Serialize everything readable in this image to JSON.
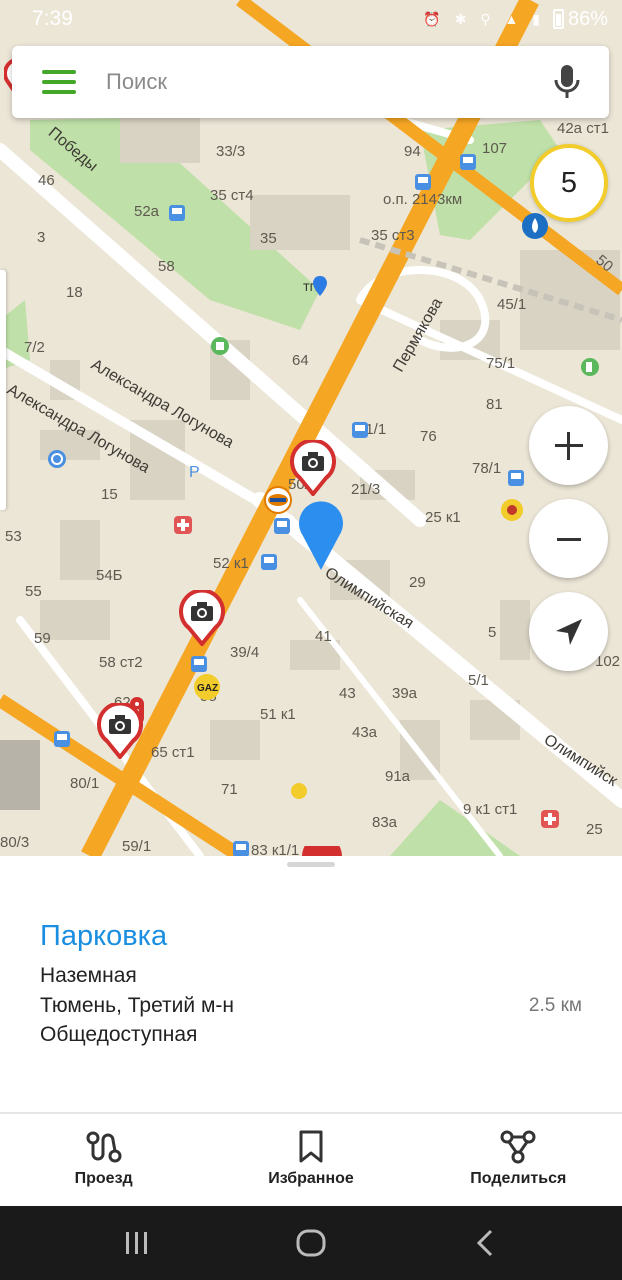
{
  "status_bar": {
    "time": "7:39",
    "battery_text": "86%",
    "icons": [
      "alarm-icon",
      "bluetooth-icon",
      "location-icon",
      "volte-icon",
      "wifi-icon",
      "4g-signal-icon",
      "signal-icon",
      "battery-icon"
    ]
  },
  "search": {
    "placeholder": "Поиск"
  },
  "traffic": {
    "score": "5",
    "color": "#f2cc2a"
  },
  "map": {
    "streets": {
      "pobedy": "Победы",
      "logunova_1": "Александра Логунова",
      "logunova_2": "Александра Логунова",
      "permyakova": "Пермякова",
      "olimpiyskaya_1": "Олимпийская",
      "olimpiyskaya_2": "Олимпийск"
    },
    "stop_label": "о.п. 2143км",
    "tpk_label": "ТПК",
    "gaz_label": "GAZ",
    "house_numbers": {
      "h33_3": "33/3",
      "h94": "94",
      "h107": "107",
      "h42a": "42а ст1",
      "h46": "46",
      "h52a": "52а",
      "h35st4": "35 ст4",
      "h35": "35",
      "h35st3": "35 ст3",
      "h50": "50",
      "h3": "3",
      "h58": "58",
      "h18": "18",
      "h45_1": "45/1",
      "h7_2": "7/2",
      "h64": "64",
      "h75_1": "75/1",
      "h81": "81",
      "h76": "76",
      "h21_1": "21/1",
      "h78_1": "78/1",
      "h15": "15",
      "h50_1": "50/1",
      "h21_3": "21/3",
      "h25k1": "25 к1",
      "h53": "53",
      "h52k1": "52 к1",
      "h54b": "54Б",
      "h29": "29",
      "h55": "55",
      "h59": "59",
      "h41": "41",
      "h5": "5",
      "h102": "102",
      "h58st2": "58 ст2",
      "h39_4": "39/4",
      "h5_1": "5/1",
      "h62": "62",
      "h55b": "55",
      "h43": "43",
      "h39a": "39а",
      "h51k1": "51 к1",
      "h65st1": "65 ст1",
      "h43a": "43а",
      "h80_1": "80/1",
      "h71": "71",
      "h91a": "91а",
      "h9k1st1": "9 к1 ст1",
      "h83a": "83а",
      "h80_3": "80/3",
      "h59_1": "59/1",
      "h83k1": "83 к1/1",
      "h25": "25"
    }
  },
  "place": {
    "title": "Парковка",
    "type": "Наземная",
    "address": "Тюмень, Третий м-н",
    "distance": "2.5 км",
    "access": "Общедоступная"
  },
  "actions": {
    "route": "Проезд",
    "favorites": "Избранное",
    "share": "Поделиться"
  },
  "colors": {
    "accent_green": "#43a827",
    "title_blue": "#1a8ee0",
    "road_orange": "#f5a623",
    "camera_red": "#d32f2f"
  }
}
